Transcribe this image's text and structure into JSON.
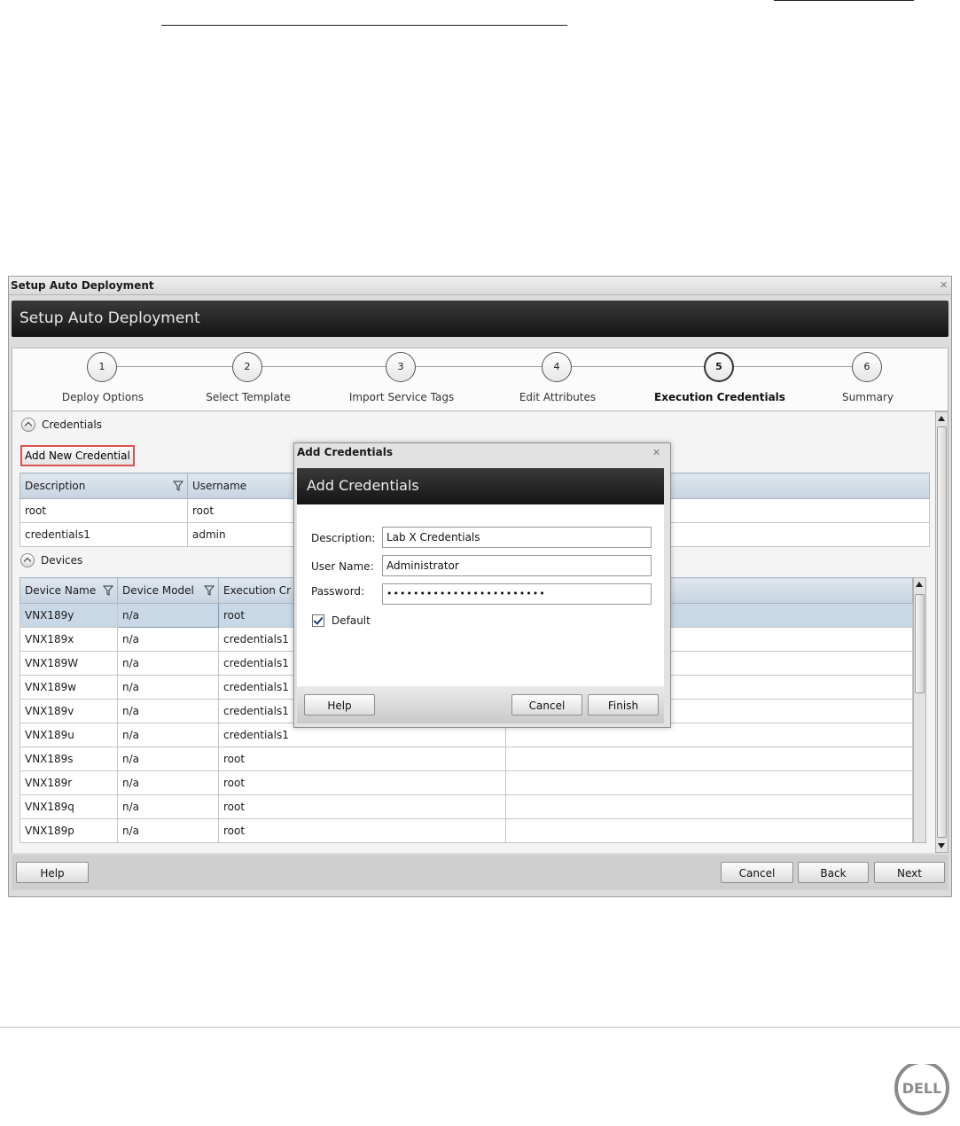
{
  "window": {
    "title": "Setup Auto Deployment",
    "banner_title": "Setup Auto Deployment"
  },
  "steps": [
    {
      "number": "1",
      "label": "Deploy Options"
    },
    {
      "number": "2",
      "label": "Select Template"
    },
    {
      "number": "3",
      "label": "Import Service Tags"
    },
    {
      "number": "4",
      "label": "Edit Attributes"
    },
    {
      "number": "5",
      "label": "Execution Credentials"
    },
    {
      "number": "6",
      "label": "Summary"
    }
  ],
  "active_step": 5,
  "credentials": {
    "section_title": "Credentials",
    "add_button": "Add New Credential",
    "columns": [
      "Description",
      "Username"
    ],
    "rows": [
      {
        "description": "root",
        "username": "root"
      },
      {
        "description": "credentials1",
        "username": "admin"
      }
    ]
  },
  "devices": {
    "section_title": "Devices",
    "columns": [
      "Device Name",
      "Device Model",
      "Execution Cr"
    ],
    "rows": [
      {
        "name": "VNX189y",
        "model": "n/a",
        "credential": "root"
      },
      {
        "name": "VNX189x",
        "model": "n/a",
        "credential": "credentials1"
      },
      {
        "name": "VNX189W",
        "model": "n/a",
        "credential": "credentials1"
      },
      {
        "name": "VNX189w",
        "model": "n/a",
        "credential": "credentials1"
      },
      {
        "name": "VNX189v",
        "model": "n/a",
        "credential": "credentials1"
      },
      {
        "name": "VNX189u",
        "model": "n/a",
        "credential": "credentials1"
      },
      {
        "name": "VNX189s",
        "model": "n/a",
        "credential": "root"
      },
      {
        "name": "VNX189r",
        "model": "n/a",
        "credential": "root"
      },
      {
        "name": "VNX189q",
        "model": "n/a",
        "credential": "root"
      },
      {
        "name": "VNX189p",
        "model": "n/a",
        "credential": "root"
      }
    ]
  },
  "footer": {
    "help": "Help",
    "cancel": "Cancel",
    "back": "Back",
    "next": "Next"
  },
  "dialog": {
    "title": "Add Credentials",
    "banner_title": "Add Credentials",
    "description_label": "Description:",
    "description_value": "Lab X Credentials",
    "username_label": "User Name:",
    "username_value": "Administrator",
    "password_label": "Password:",
    "password_value": "••••••••••••••••••••••••",
    "default_label": "Default",
    "default_checked": true,
    "help": "Help",
    "cancel": "Cancel",
    "finish": "Finish"
  },
  "icons": {
    "close": "close-icon",
    "filter": "filter-funnel-icon",
    "collapse": "collapse-chevron-icon"
  },
  "colors": {
    "banner_dark": "#1a1a1a",
    "highlight_border": "#d9534f",
    "selected_row": "#c8d8e6",
    "grid_header": "#c6d3df"
  }
}
